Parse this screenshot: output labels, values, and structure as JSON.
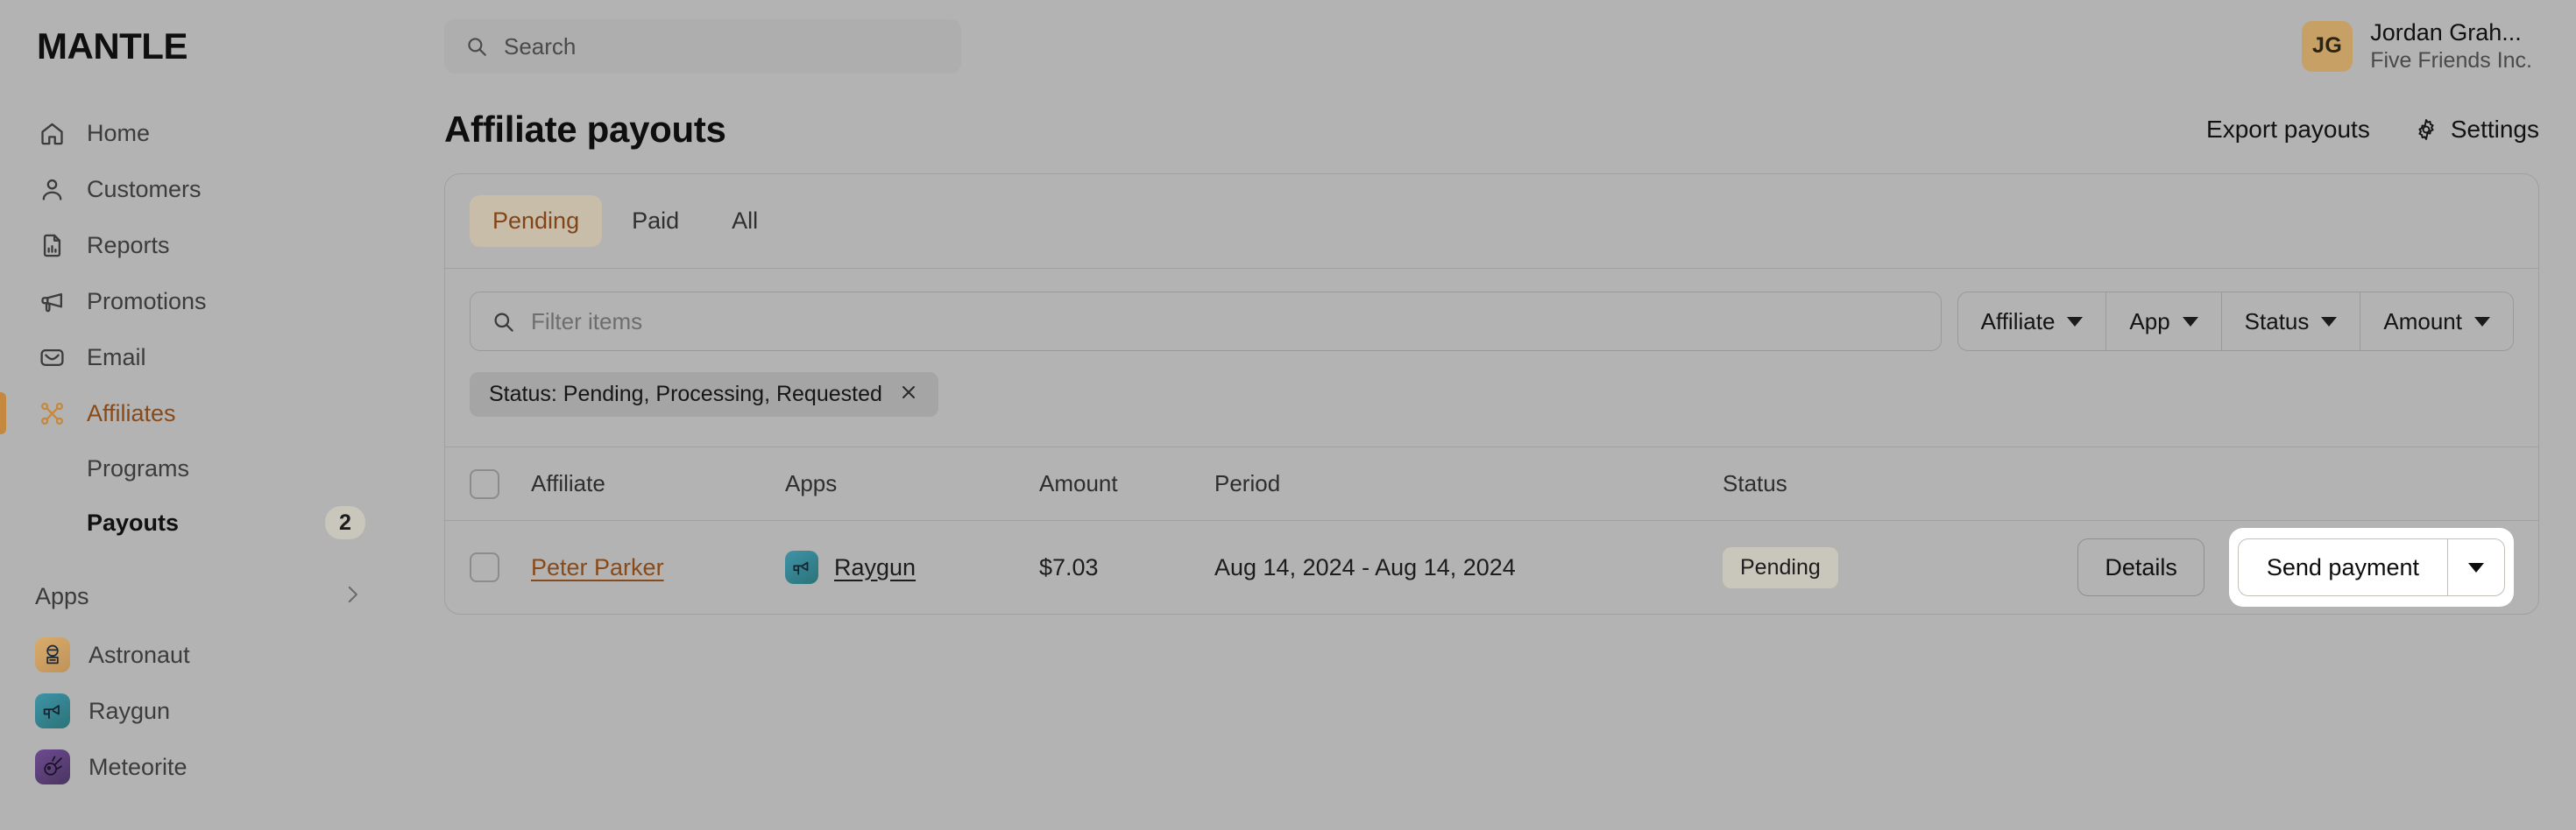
{
  "brand": {
    "name": "MANTLE"
  },
  "topbar": {
    "search": {
      "placeholder": "Search",
      "value": "",
      "icon": "search-icon"
    },
    "user": {
      "initials": "JG",
      "name": "Jordan Grah...",
      "org": "Five Friends Inc."
    }
  },
  "sidebar": {
    "items": [
      {
        "label": "Home",
        "icon": "home-icon",
        "active": false
      },
      {
        "label": "Customers",
        "icon": "user-icon",
        "active": false
      },
      {
        "label": "Reports",
        "icon": "report-document-icon",
        "active": false
      },
      {
        "label": "Promotions",
        "icon": "megaphone-icon",
        "active": false
      },
      {
        "label": "Email",
        "icon": "envelope-icon",
        "active": false
      },
      {
        "label": "Affiliates",
        "icon": "affiliates-network-icon",
        "active": true
      }
    ],
    "subitems": [
      {
        "label": "Programs",
        "badge": "",
        "current": false
      },
      {
        "label": "Payouts",
        "badge": "2",
        "current": true
      }
    ],
    "apps_section": {
      "label": "Apps",
      "chevron": "chevron-right-icon"
    },
    "apps": [
      {
        "label": "Astronaut",
        "icon": "astronaut-icon",
        "color_start": "#d6a869",
        "color_end": "#c29a62"
      },
      {
        "label": "Raygun",
        "icon": "raygun-icon",
        "color_start": "#3b8ca3",
        "color_end": "#2f7b7e"
      },
      {
        "label": "Meteorite",
        "icon": "meteorite-icon",
        "color_start": "#6b4a8c",
        "color_end": "#4f3a63"
      }
    ]
  },
  "page": {
    "title": "Affiliate payouts",
    "actions": {
      "export_label": "Export payouts",
      "settings_label": "Settings",
      "settings_icon": "gear-icon"
    }
  },
  "tabs": [
    {
      "label": "Pending",
      "active": true
    },
    {
      "label": "Paid",
      "active": false
    },
    {
      "label": "All",
      "active": false
    }
  ],
  "filters": {
    "input": {
      "placeholder": "Filter items",
      "value": "",
      "icon": "search-icon"
    },
    "dropdowns": [
      {
        "label": "Affiliate"
      },
      {
        "label": "App"
      },
      {
        "label": "Status"
      },
      {
        "label": "Amount"
      }
    ],
    "chips": [
      {
        "label": "Status: Pending, Processing, Requested",
        "remove_icon": "close-icon"
      }
    ]
  },
  "table": {
    "columns": [
      "Affiliate",
      "Apps",
      "Amount",
      "Period",
      "Status"
    ],
    "rows": [
      {
        "selected": false,
        "affiliate": "Peter Parker",
        "app": "Raygun",
        "app_icon": "raygun-icon",
        "app_color_start": "#3b8ca3",
        "app_color_end": "#2f7b7e",
        "amount": "$7.03",
        "period": "Aug 14, 2024 - Aug 14, 2024",
        "status": "Pending",
        "details_label": "Details",
        "send_label": "Send payment",
        "send_caret_icon": "chevron-down-icon"
      }
    ]
  },
  "colors": {
    "accent": "#c4893f",
    "accent_text": "#8a4a18",
    "tab_active_bg": "#c7bda9",
    "badge_bg": "#c9c6bc",
    "page_bg": "#b3b3b3",
    "highlight": "#ffffff"
  }
}
